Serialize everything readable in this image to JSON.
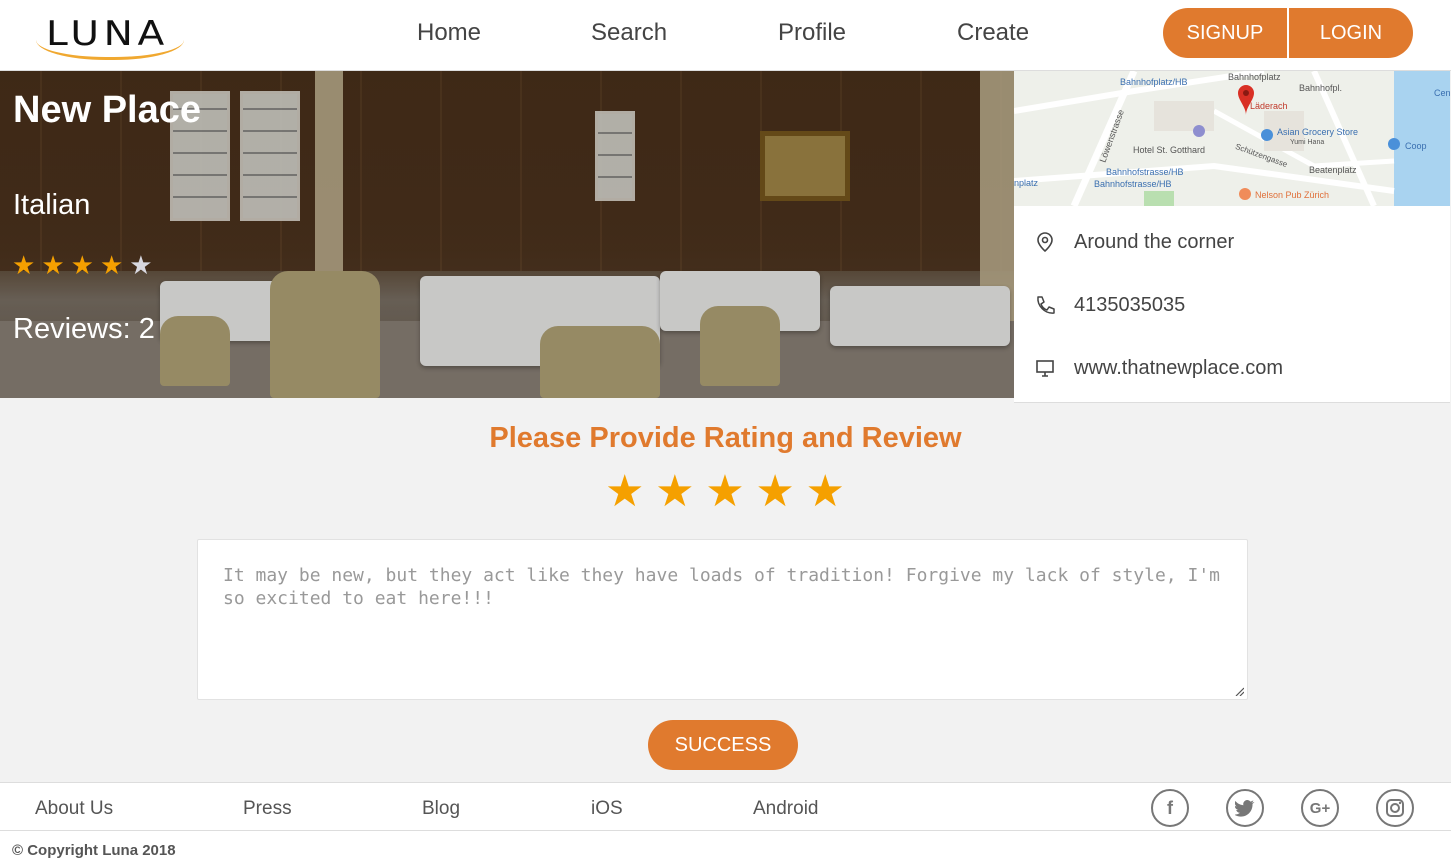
{
  "header": {
    "logo_text": "LUNA",
    "nav": [
      "Home",
      "Search",
      "Profile",
      "Create"
    ],
    "signup_label": "SIGNUP",
    "login_label": "LOGIN"
  },
  "place": {
    "name": "New Place",
    "cuisine": "Italian",
    "rating": 4,
    "rating_max": 5,
    "reviews_text": "Reviews: 2",
    "address": "Around the corner",
    "phone": "4135035035",
    "website": "www.thatnewplace.com"
  },
  "map": {
    "labels": [
      "Bahnhofplatz/HB",
      "Bahnhofplatz",
      "Bahnhofpl.",
      "Läderach",
      "Asian Grocery Store",
      "Yumi Hana",
      "Coop",
      "Hotel St. Gotthard",
      "Schützengasse",
      "Bahnhofstrasse/HB",
      "Bahnhofstrasse/HB",
      "Beatenplatz",
      "Löwenstrasse",
      "Nelson Pub Zürich",
      "Cen",
      "nplatz"
    ]
  },
  "review": {
    "title": "Please Provide Rating and Review",
    "stars": 5,
    "text": "It may be new, but they act like they have loads of tradition! Forgive my lack of style, I'm so excited to eat here!!!",
    "submit_label": "SUCCESS"
  },
  "footer": {
    "links": [
      "About Us",
      "Press",
      "Blog",
      "iOS",
      "Android"
    ],
    "social": [
      "facebook-icon",
      "twitter-icon",
      "google-plus-icon",
      "instagram-icon"
    ],
    "copyright": "© Copyright Luna 2018"
  },
  "colors": {
    "accent": "#e07a2e",
    "star": "#f5a000"
  }
}
